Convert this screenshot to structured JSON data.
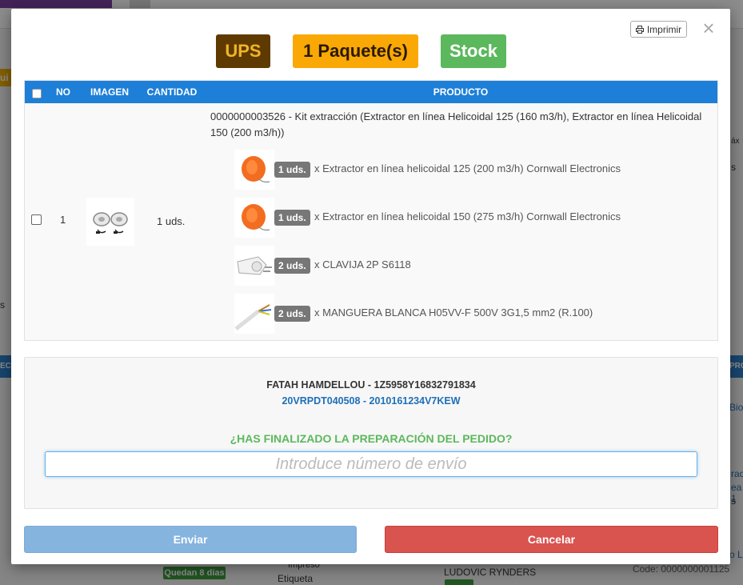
{
  "background": {
    "right_fragments": [
      "áx",
      "s",
      "Bio",
      "ract",
      "ea 1",
      "s",
      "o L",
      "PRO"
    ],
    "left_fragments": [
      "ui",
      "s",
      "ECI"
    ],
    "status_badge": "Quedan 8 días",
    "printed_label": "Impreso",
    "label_text": "Etiqueta",
    "customer": "LUDOVIC RYNDERS",
    "code": "Code: 0000000001125"
  },
  "modal": {
    "print_label": "Imprimir",
    "close_label": "×",
    "carrier": "UPS",
    "packages": "1 Paquete(s)",
    "stock": "Stock",
    "colors": {
      "header_blue": "#1e7fd8",
      "carrier_bg": "#5e3a00",
      "carrier_fg": "#f0b428",
      "packages_bg": "#f9a805",
      "stock_bg": "#5cb85c",
      "send": "#85b4de",
      "cancel": "#d9534f"
    }
  },
  "table": {
    "headers": {
      "no": "NO",
      "image": "IMAGEN",
      "quantity": "CANTIDAD",
      "product": "PRODUCTO"
    },
    "row": {
      "no": "1",
      "quantity": "1 uds.",
      "title": "0000000003526 - Kit extracción (Extractor en línea Helicoidal 125 (160 m3/h), Extractor en línea Helicoidal 150 (200 m3/h))",
      "components": [
        {
          "qty": "1 uds.",
          "name": "x Extractor en línea helicoidal 125 (200 m3/h) Cornwall Electronics",
          "icon": "extractor-orange"
        },
        {
          "qty": "1 uds.",
          "name": "x Extractor en línea helicoidal 150 (275 m3/h) Cornwall Electronics",
          "icon": "extractor-orange"
        },
        {
          "qty": "2 uds.",
          "name": "x CLAVIJA 2P S6118",
          "icon": "plug"
        },
        {
          "qty": "2 uds.",
          "name": "x MANGUERA BLANCA H05VV-F 500V 3G1,5 mm2 (R.100)",
          "icon": "cable"
        }
      ]
    }
  },
  "shipping": {
    "recipient": "FATAH HAMDELLOU - 1Z5958Y16832791834",
    "reference": "20VRPDT040508 - 2010161234V7KEW",
    "question": "¿HAS FINALIZADO LA PREPARACIÓN DEL PEDIDO?",
    "input_value": "",
    "input_placeholder": "Introduce número de envío"
  },
  "actions": {
    "send": "Enviar",
    "cancel": "Cancelar"
  }
}
